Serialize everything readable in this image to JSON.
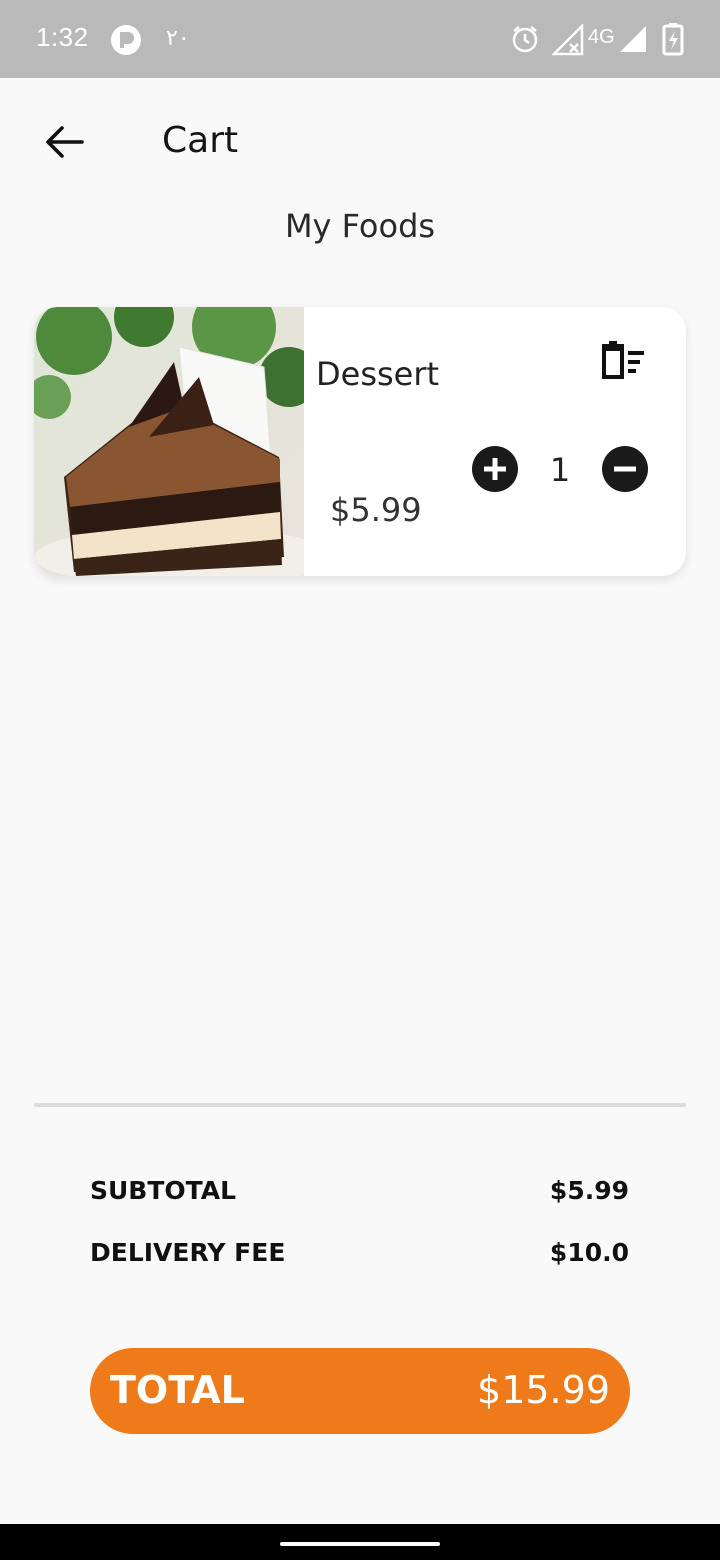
{
  "status_bar": {
    "time": "1:32",
    "arabic_indicator": "٢٠",
    "network": "4G",
    "icons": [
      "p-app-icon",
      "alarm-icon",
      "no-signal-icon",
      "signal-icon",
      "battery-charging-icon"
    ]
  },
  "header": {
    "back_icon": "arrow-left-icon",
    "title": "Cart"
  },
  "section_title": "My Foods",
  "cart_items": [
    {
      "name": "Dessert",
      "price": "$5.99",
      "quantity": "1",
      "image": "chocolate-cake-image",
      "delete_icon": "delete-sweep-icon",
      "plus_icon": "plus-circle-icon",
      "minus_icon": "minus-circle-icon"
    }
  ],
  "summary": {
    "subtotal_label": "SUBTOTAL",
    "subtotal_value": "$5.99",
    "delivery_label": "DELIVERY FEE",
    "delivery_value": "$10.0"
  },
  "total": {
    "label": "TOTAL",
    "value": "$15.99"
  },
  "colors": {
    "accent": "#ef7a1a",
    "background": "#f9f9f9",
    "status_bar": "#b9b9b9"
  }
}
